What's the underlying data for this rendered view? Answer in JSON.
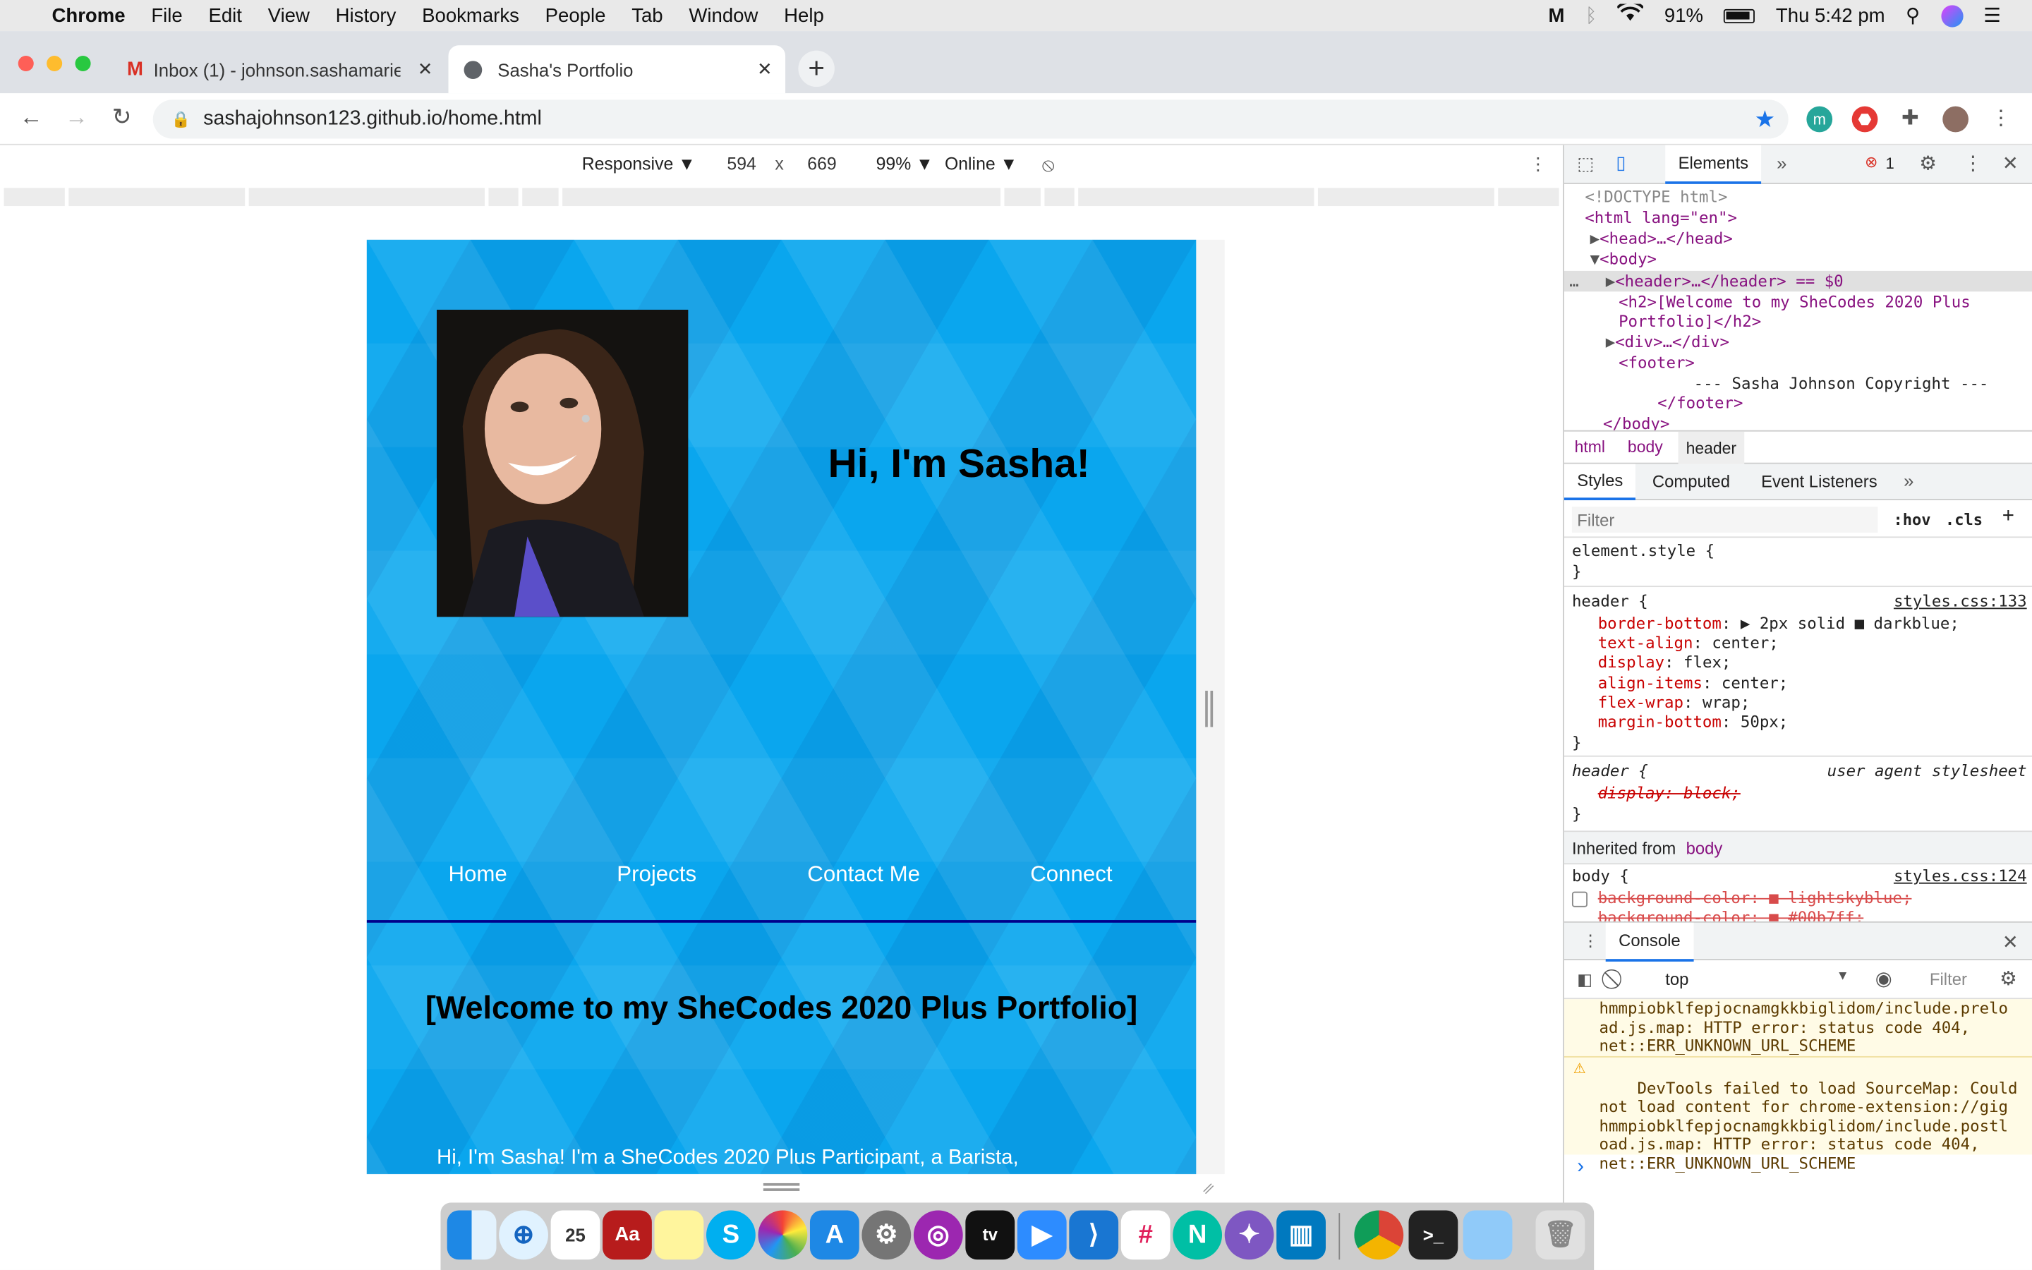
{
  "menubar": {
    "app": "Chrome",
    "items": [
      "File",
      "Edit",
      "View",
      "History",
      "Bookmarks",
      "People",
      "Tab",
      "Window",
      "Help"
    ],
    "battery": "91%",
    "clock": "Thu 5:42 pm"
  },
  "tabs": [
    {
      "title": "Inbox (1) - johnson.sashamarie",
      "icon": "gmail-icon"
    },
    {
      "title": "Sasha's Portfolio",
      "icon": "globe-icon"
    }
  ],
  "address": {
    "url": "sashajohnson123.github.io/home.html"
  },
  "device_toolbar": {
    "mode": "Responsive ▼",
    "width": "594",
    "x": "x",
    "height": "669",
    "zoom": "99% ▼",
    "network": "Online ▼"
  },
  "page": {
    "greeting": "Hi, I'm Sasha!",
    "nav": [
      "Home",
      "Projects",
      "Contact Me",
      "Connect"
    ],
    "welcome": "[Welcome to my SheCodes 2020 Plus Portfolio]",
    "intro": "Hi, I'm Sasha! I'm a SheCodes 2020 Plus Participant, a Barista,"
  },
  "devtools": {
    "tabs": {
      "elements": "Elements",
      "more": "»",
      "errors": "1"
    },
    "dom": [
      "<!DOCTYPE html>",
      "<html lang=\"en\">",
      "<head>…</head>",
      "<body>",
      "<header>…</header> == $0",
      "<h2>[Welcome to my SheCodes 2020 Plus",
      "Portfolio]</h2>",
      "<div>…</div>",
      "<footer>",
      "--- Sasha Johnson Copyright ---",
      "</footer>",
      "</body>"
    ],
    "breadcrumb": [
      "html",
      "body",
      "header"
    ],
    "style_tabs": [
      "Styles",
      "Computed",
      "Event Listeners",
      "»"
    ],
    "filter_placeholder": "Filter",
    "hov": ":hov",
    "cls": ".cls",
    "plus": "+",
    "element_style": "element.style {",
    "close_brace": "}",
    "header_rule": {
      "selector": "header {",
      "source": "styles.css:133",
      "decls": [
        {
          "p": "border-bottom",
          "v": "▶ 2px solid ■ darkblue;"
        },
        {
          "p": "text-align",
          "v": "center;"
        },
        {
          "p": "display",
          "v": "flex;"
        },
        {
          "p": "align-items",
          "v": "center;"
        },
        {
          "p": "flex-wrap",
          "v": "wrap;"
        },
        {
          "p": "margin-bottom",
          "v": "50px;"
        }
      ]
    },
    "ua_rule": {
      "selector": "header {",
      "source": "user agent stylesheet",
      "decl": "display: block;"
    },
    "inherited": "Inherited from",
    "inherited_el": "body",
    "body_rule": {
      "selector": "body {",
      "source": "styles.css:124",
      "decls": [
        "background-color: ■ lightskyblue;",
        "background-color: ■ #00b7ff;"
      ]
    },
    "console": {
      "title": "Console",
      "context": "top",
      "filter": "Filter",
      "lines1": "hmmpiobklfepjocnamgkkbiglidom/include.prelo\nad.js.map: HTTP error: status code 404,\nnet::ERR_UNKNOWN_URL_SCHEME",
      "lines2": "DevTools failed to load SourceMap: Could\nnot load content for chrome-extension://gig\nhmmpiobklfepjocnamgkkbiglidom/include.postl\noad.js.map: HTTP error: status code 404,\nnet::ERR_UNKNOWN_URL_SCHEME",
      "prompt": "›"
    }
  },
  "colors": {
    "page_bg": "#0aa6ee",
    "header_border": "#00008b",
    "selected_tab": "#ffffff"
  }
}
